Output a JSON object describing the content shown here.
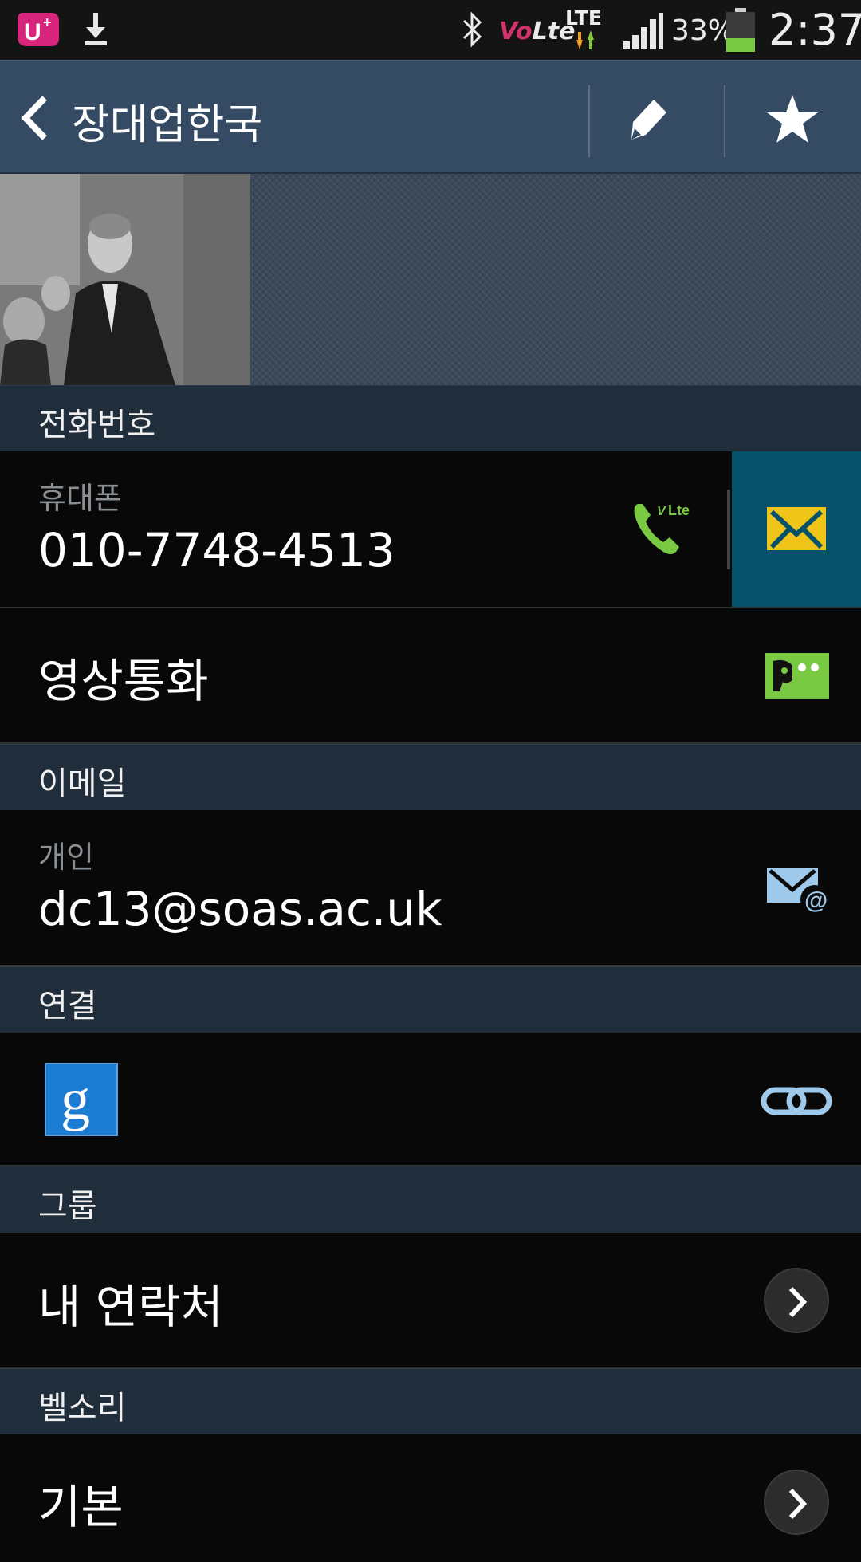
{
  "status_bar": {
    "volte_v": "Vo",
    "volte_l": "Lte",
    "network": "LTE",
    "battery_pct": "33%",
    "battery_level": 0.33,
    "time": "2:37",
    "icons": [
      "uplus-icon",
      "download-icon",
      "bluetooth-icon",
      "volte-icon",
      "lte-data-icon",
      "signal-icon",
      "battery-icon"
    ]
  },
  "action_bar": {
    "title": "장대업한국",
    "back_icon": "chevron-left-icon",
    "edit_icon": "pencil-icon",
    "star_icon": "star-icon"
  },
  "sections": {
    "phone": "전화번호",
    "email": "이메일",
    "connection": "연결",
    "group": "그룹",
    "ringtone": "벨소리"
  },
  "phone_row": {
    "label": "휴대폰",
    "number": "010-7748-4513",
    "call_badge": "Lte"
  },
  "video_call": {
    "label": "영상통화"
  },
  "email_row": {
    "label": "개인",
    "address": "dc13@soas.ac.uk"
  },
  "connection_row": {
    "google_letter": "g"
  },
  "group_row": {
    "value": "내 연락처"
  },
  "ringtone_row": {
    "value": "기본"
  },
  "colors": {
    "action_bar": "#354b63",
    "section_header": "#202d3b",
    "row_bg": "#080808",
    "message_bg": "#05526a",
    "accent_green": "#7ac943",
    "envelope_yellow": "#f0c419",
    "google_blue": "#1b7cd1"
  }
}
